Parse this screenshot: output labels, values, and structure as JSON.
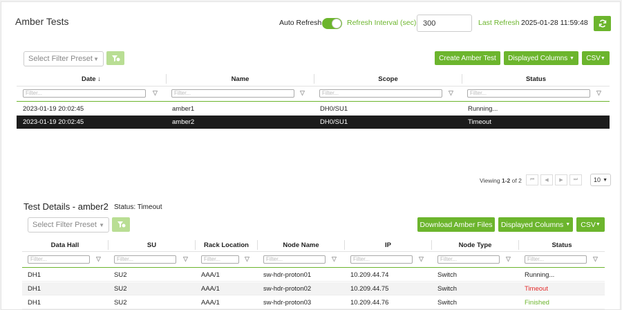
{
  "header": {
    "title": "Amber Tests",
    "auto_refresh_label": "Auto Refresh",
    "auto_refresh_on": true,
    "refresh_interval_label": "Refresh Interval (sec)",
    "refresh_interval_value": "300",
    "last_refresh_label": "Last Refresh",
    "last_refresh_value": "2025-01-28 11:59:48"
  },
  "tests_toolbar": {
    "filter_preset_placeholder": "Select Filter Preset",
    "create_label": "Create Amber Test",
    "displayed_columns_label": "Displayed Columns",
    "csv_label": "CSV"
  },
  "tests_table": {
    "columns": [
      "Date",
      "Name",
      "Scope",
      "Status"
    ],
    "sort_indicator": "↓",
    "filter_placeholder": "Filter...",
    "rows": [
      {
        "date": "2023-01-19 20:02:45",
        "name": "amber1",
        "scope": "DH0/SU1",
        "status": "Running...",
        "selected": false
      },
      {
        "date": "2023-01-19 20:02:45",
        "name": "amber2",
        "scope": "DH0/SU1",
        "status": "Timeout",
        "selected": true
      }
    ]
  },
  "pagination": {
    "viewing_prefix": "Viewing",
    "range": "1-2",
    "of_label": "of",
    "total": "2",
    "page_size": "10"
  },
  "details": {
    "title": "Test Details - amber2",
    "status_text": "Status: Timeout",
    "filter_preset_placeholder": "Select Filter Preset",
    "download_label": "Download Amber Files",
    "displayed_columns_label": "Displayed Columns",
    "csv_label": "CSV",
    "columns": [
      "Data Hall",
      "SU",
      "Rack Location",
      "Node Name",
      "IP",
      "Node Type",
      "Status"
    ],
    "filter_placeholder": "Filter...",
    "rows": [
      {
        "hall": "DH1",
        "su": "SU2",
        "rack": "AAA/1",
        "node": "sw-hdr-proton01",
        "ip": "10.209.44.74",
        "type": "Switch",
        "status": "Running..."
      },
      {
        "hall": "DH1",
        "su": "SU2",
        "rack": "AAA/1",
        "node": "sw-hdr-proton02",
        "ip": "10.209.44.75",
        "type": "Switch",
        "status": "Timeout"
      },
      {
        "hall": "DH1",
        "su": "SU2",
        "rack": "AAA/1",
        "node": "sw-hdr-proton03",
        "ip": "10.209.44.76",
        "type": "Switch",
        "status": "Finished"
      }
    ]
  },
  "colors": {
    "accent": "#6cb52d",
    "selected_row": "#1c1c1c",
    "error": "#e32b2b"
  }
}
